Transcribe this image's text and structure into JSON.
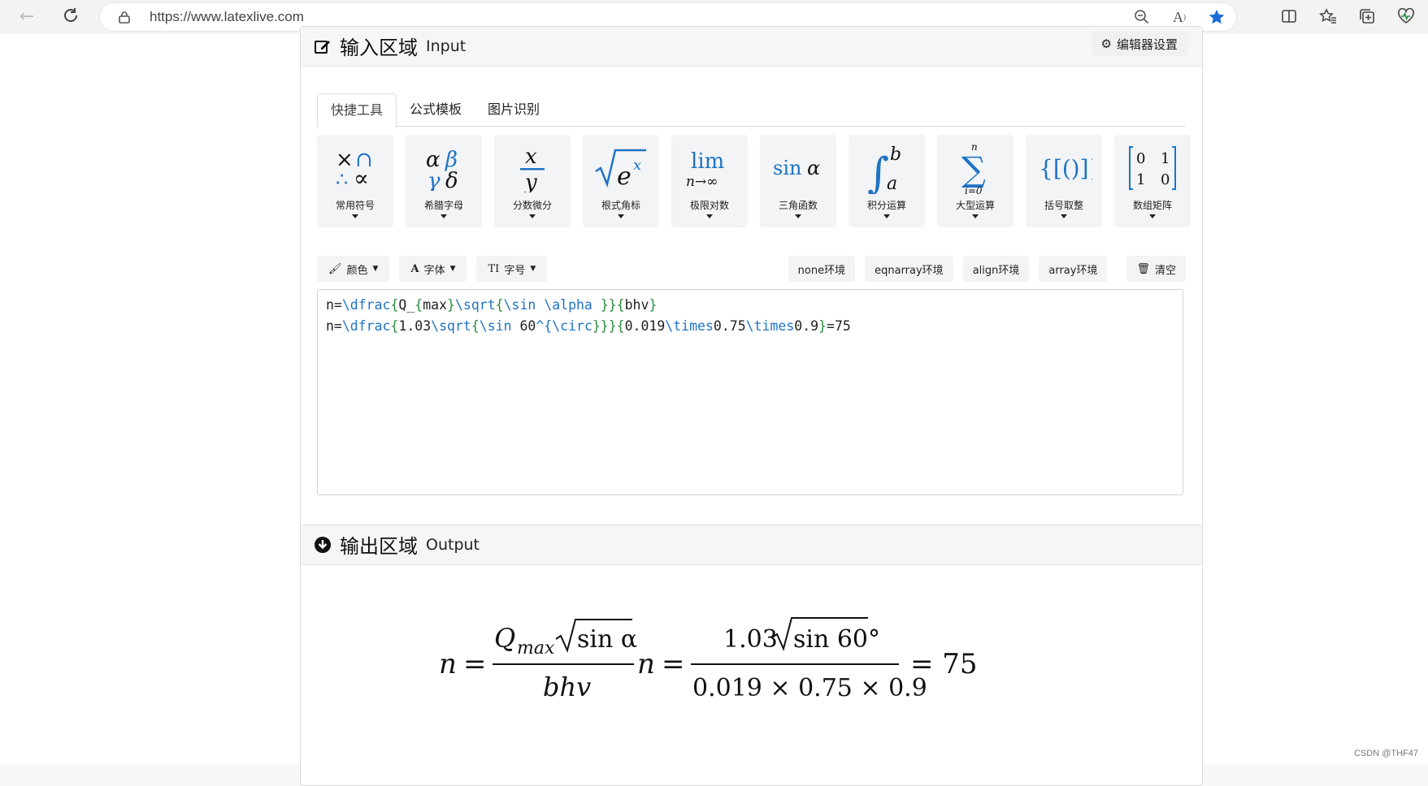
{
  "browser": {
    "url": "https://www.latexlive.com"
  },
  "input_panel": {
    "title": "输入区域",
    "title_en": "Input",
    "settings_label": "编辑器设置",
    "tabs": [
      {
        "label": "快捷工具",
        "active": true
      },
      {
        "label": "公式模板",
        "active": false
      },
      {
        "label": "图片识别",
        "active": false
      }
    ],
    "tools": [
      {
        "label": "常用符号",
        "icon": "times-cap-therefore-propto"
      },
      {
        "label": "希腊字母",
        "icon": "alpha-beta-gamma-delta"
      },
      {
        "label": "分数微分",
        "icon": "fraction-x-over-y"
      },
      {
        "label": "根式角标",
        "icon": "sqrt-e-power-x"
      },
      {
        "label": "极限对数",
        "icon": "lim-n-to-infinity"
      },
      {
        "label": "三角函数",
        "icon": "sin-alpha"
      },
      {
        "label": "积分运算",
        "icon": "integral-a-b"
      },
      {
        "label": "大型运算",
        "icon": "sum-i-0-n"
      },
      {
        "label": "括号取整",
        "icon": "nested-brackets"
      },
      {
        "label": "数组矩阵",
        "icon": "matrix-2x2"
      }
    ],
    "format_buttons": [
      {
        "label": "颜色",
        "icon": "brush-icon"
      },
      {
        "label": "字体",
        "icon": "font-a-icon"
      },
      {
        "label": "字号",
        "icon": "text-size-icon"
      }
    ],
    "env_buttons": [
      "none环境",
      "eqnarray环境",
      "align环境",
      "array环境"
    ],
    "clear_label": "清空",
    "editor_lines": [
      [
        {
          "t": "n=",
          "c": "t"
        },
        {
          "t": "\\dfrac",
          "c": "k"
        },
        {
          "t": "{",
          "c": "g"
        },
        {
          "t": "Q_",
          "c": "t"
        },
        {
          "t": "{",
          "c": "g"
        },
        {
          "t": "max",
          "c": "t"
        },
        {
          "t": "}",
          "c": "g"
        },
        {
          "t": "\\sqrt",
          "c": "k"
        },
        {
          "t": "{",
          "c": "g"
        },
        {
          "t": "\\sin \\alpha ",
          "c": "k"
        },
        {
          "t": "}}{",
          "c": "g"
        },
        {
          "t": "bhv",
          "c": "t"
        },
        {
          "t": "}",
          "c": "g"
        }
      ],
      [
        {
          "t": "n=",
          "c": "t"
        },
        {
          "t": "\\dfrac",
          "c": "k"
        },
        {
          "t": "{",
          "c": "g"
        },
        {
          "t": "1.03",
          "c": "t"
        },
        {
          "t": "\\sqrt",
          "c": "k"
        },
        {
          "t": "{",
          "c": "g"
        },
        {
          "t": "\\sin ",
          "c": "k"
        },
        {
          "t": "60",
          "c": "t"
        },
        {
          "t": "^{",
          "c": "k"
        },
        {
          "t": "\\circ",
          "c": "k"
        },
        {
          "t": "}}}{",
          "c": "g"
        },
        {
          "t": "0.019",
          "c": "t"
        },
        {
          "t": "\\times",
          "c": "k"
        },
        {
          "t": "0.75",
          "c": "t"
        },
        {
          "t": "\\times",
          "c": "k"
        },
        {
          "t": "0.9",
          "c": "t"
        },
        {
          "t": "}",
          "c": "g"
        },
        {
          "t": "=75",
          "c": "t"
        }
      ]
    ]
  },
  "output_panel": {
    "title": "输出区域",
    "title_en": "Output",
    "formula": {
      "n": "n",
      "eq": "=",
      "Q": "Q",
      "sub": "max",
      "sin_alpha": "sin α",
      "den1": "bhv",
      "num2": "1.03",
      "sin60": "sin 60°",
      "den2": "0.019 × 0.75 × 0.9",
      "result": "= 75"
    }
  },
  "watermark": "CSDN @THF47"
}
